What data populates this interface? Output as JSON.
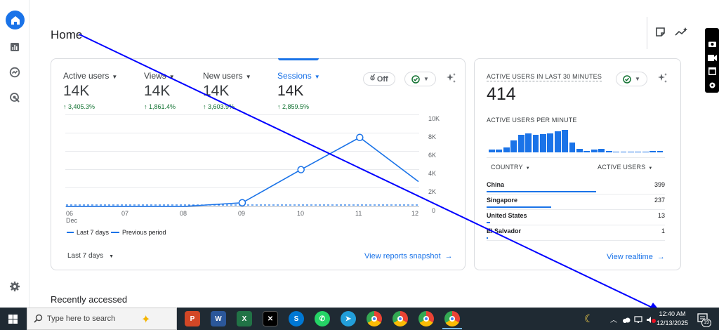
{
  "page": {
    "title": "Home",
    "recently_accessed": "Recently accessed"
  },
  "metrics": [
    {
      "label": "Active users",
      "value": "14K",
      "delta": "↑ 3,405.3%"
    },
    {
      "label": "Views",
      "value": "14K",
      "delta": "↑ 1,861.4%"
    },
    {
      "label": "New users",
      "value": "14K",
      "delta": "↑ 3,603.9%"
    },
    {
      "label": "Sessions",
      "value": "14K",
      "delta": "↑ 2,859.5%"
    }
  ],
  "card1": {
    "off_toggle": "Off",
    "date_range": "Last 7 days",
    "view_link": "View reports snapshot",
    "legend_current": "Last 7 days",
    "legend_previous": "Previous period"
  },
  "chart_data": {
    "type": "line",
    "x": [
      "06 Dec",
      "07",
      "08",
      "09",
      "10",
      "11",
      "12"
    ],
    "series": [
      {
        "name": "Last 7 days",
        "values": [
          0,
          0,
          0,
          400,
          4000,
          7500,
          2700
        ]
      },
      {
        "name": "Previous period",
        "values": [
          150,
          150,
          150,
          150,
          150,
          150,
          150
        ]
      }
    ],
    "y_ticks": [
      "10K",
      "8K",
      "6K",
      "4K",
      "2K",
      "0"
    ],
    "ylim": [
      0,
      10000
    ],
    "grid": true,
    "legend": "bottom-left",
    "colors": {
      "current": "#1a73e8",
      "previous": "#1a73e8"
    }
  },
  "realtime": {
    "heading": "ACTIVE USERS IN LAST 30 MINUTES",
    "value": "414",
    "per_minute_label": "ACTIVE USERS PER MINUTE",
    "col_country": "COUNTRY",
    "col_users": "ACTIVE USERS",
    "rows": [
      {
        "country": "China",
        "users": "399",
        "share": 1.0
      },
      {
        "country": "Singapore",
        "users": "237",
        "share": 0.59
      },
      {
        "country": "United States",
        "users": "13",
        "share": 0.03
      },
      {
        "country": "El Salvador",
        "users": "1",
        "share": 0.01
      }
    ],
    "view_link": "View realtime",
    "bars": [
      3,
      3,
      6,
      14,
      20,
      22,
      20,
      21,
      22,
      24,
      26,
      11,
      4,
      2,
      3,
      4,
      2,
      1,
      1,
      1,
      1,
      1,
      2,
      2
    ]
  },
  "taskbar": {
    "search_placeholder": "Type here to search",
    "time": "12:40 AM",
    "date": "12/13/2025",
    "notif_count": "19"
  },
  "colors": {
    "accent": "#1a73e8",
    "positive": "#137333",
    "annotation": "#0000ff"
  }
}
